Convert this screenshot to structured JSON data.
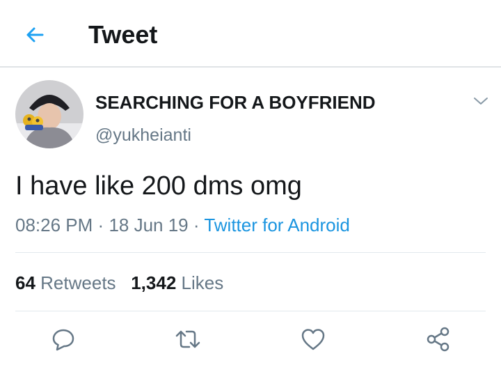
{
  "header": {
    "back_icon": "arrow-left-icon",
    "title": "Tweet",
    "accent_color": "#1da1f2"
  },
  "tweet": {
    "display_name": "SEARCHING FOR A BOYFRIEND",
    "handle": "@yukheianti",
    "text": "I have like 200 dms omg",
    "time": "08:26 PM",
    "separator": "·",
    "date": "18 Jun 19",
    "source": "Twitter for Android",
    "source_color": "#1b95e0"
  },
  "stats": {
    "retweets_count": "64",
    "retweets_label": "Retweets",
    "likes_count": "1,342",
    "likes_label": "Likes"
  },
  "actions": {
    "icons": [
      "reply-icon",
      "retweet-icon",
      "like-icon",
      "share-icon"
    ]
  }
}
